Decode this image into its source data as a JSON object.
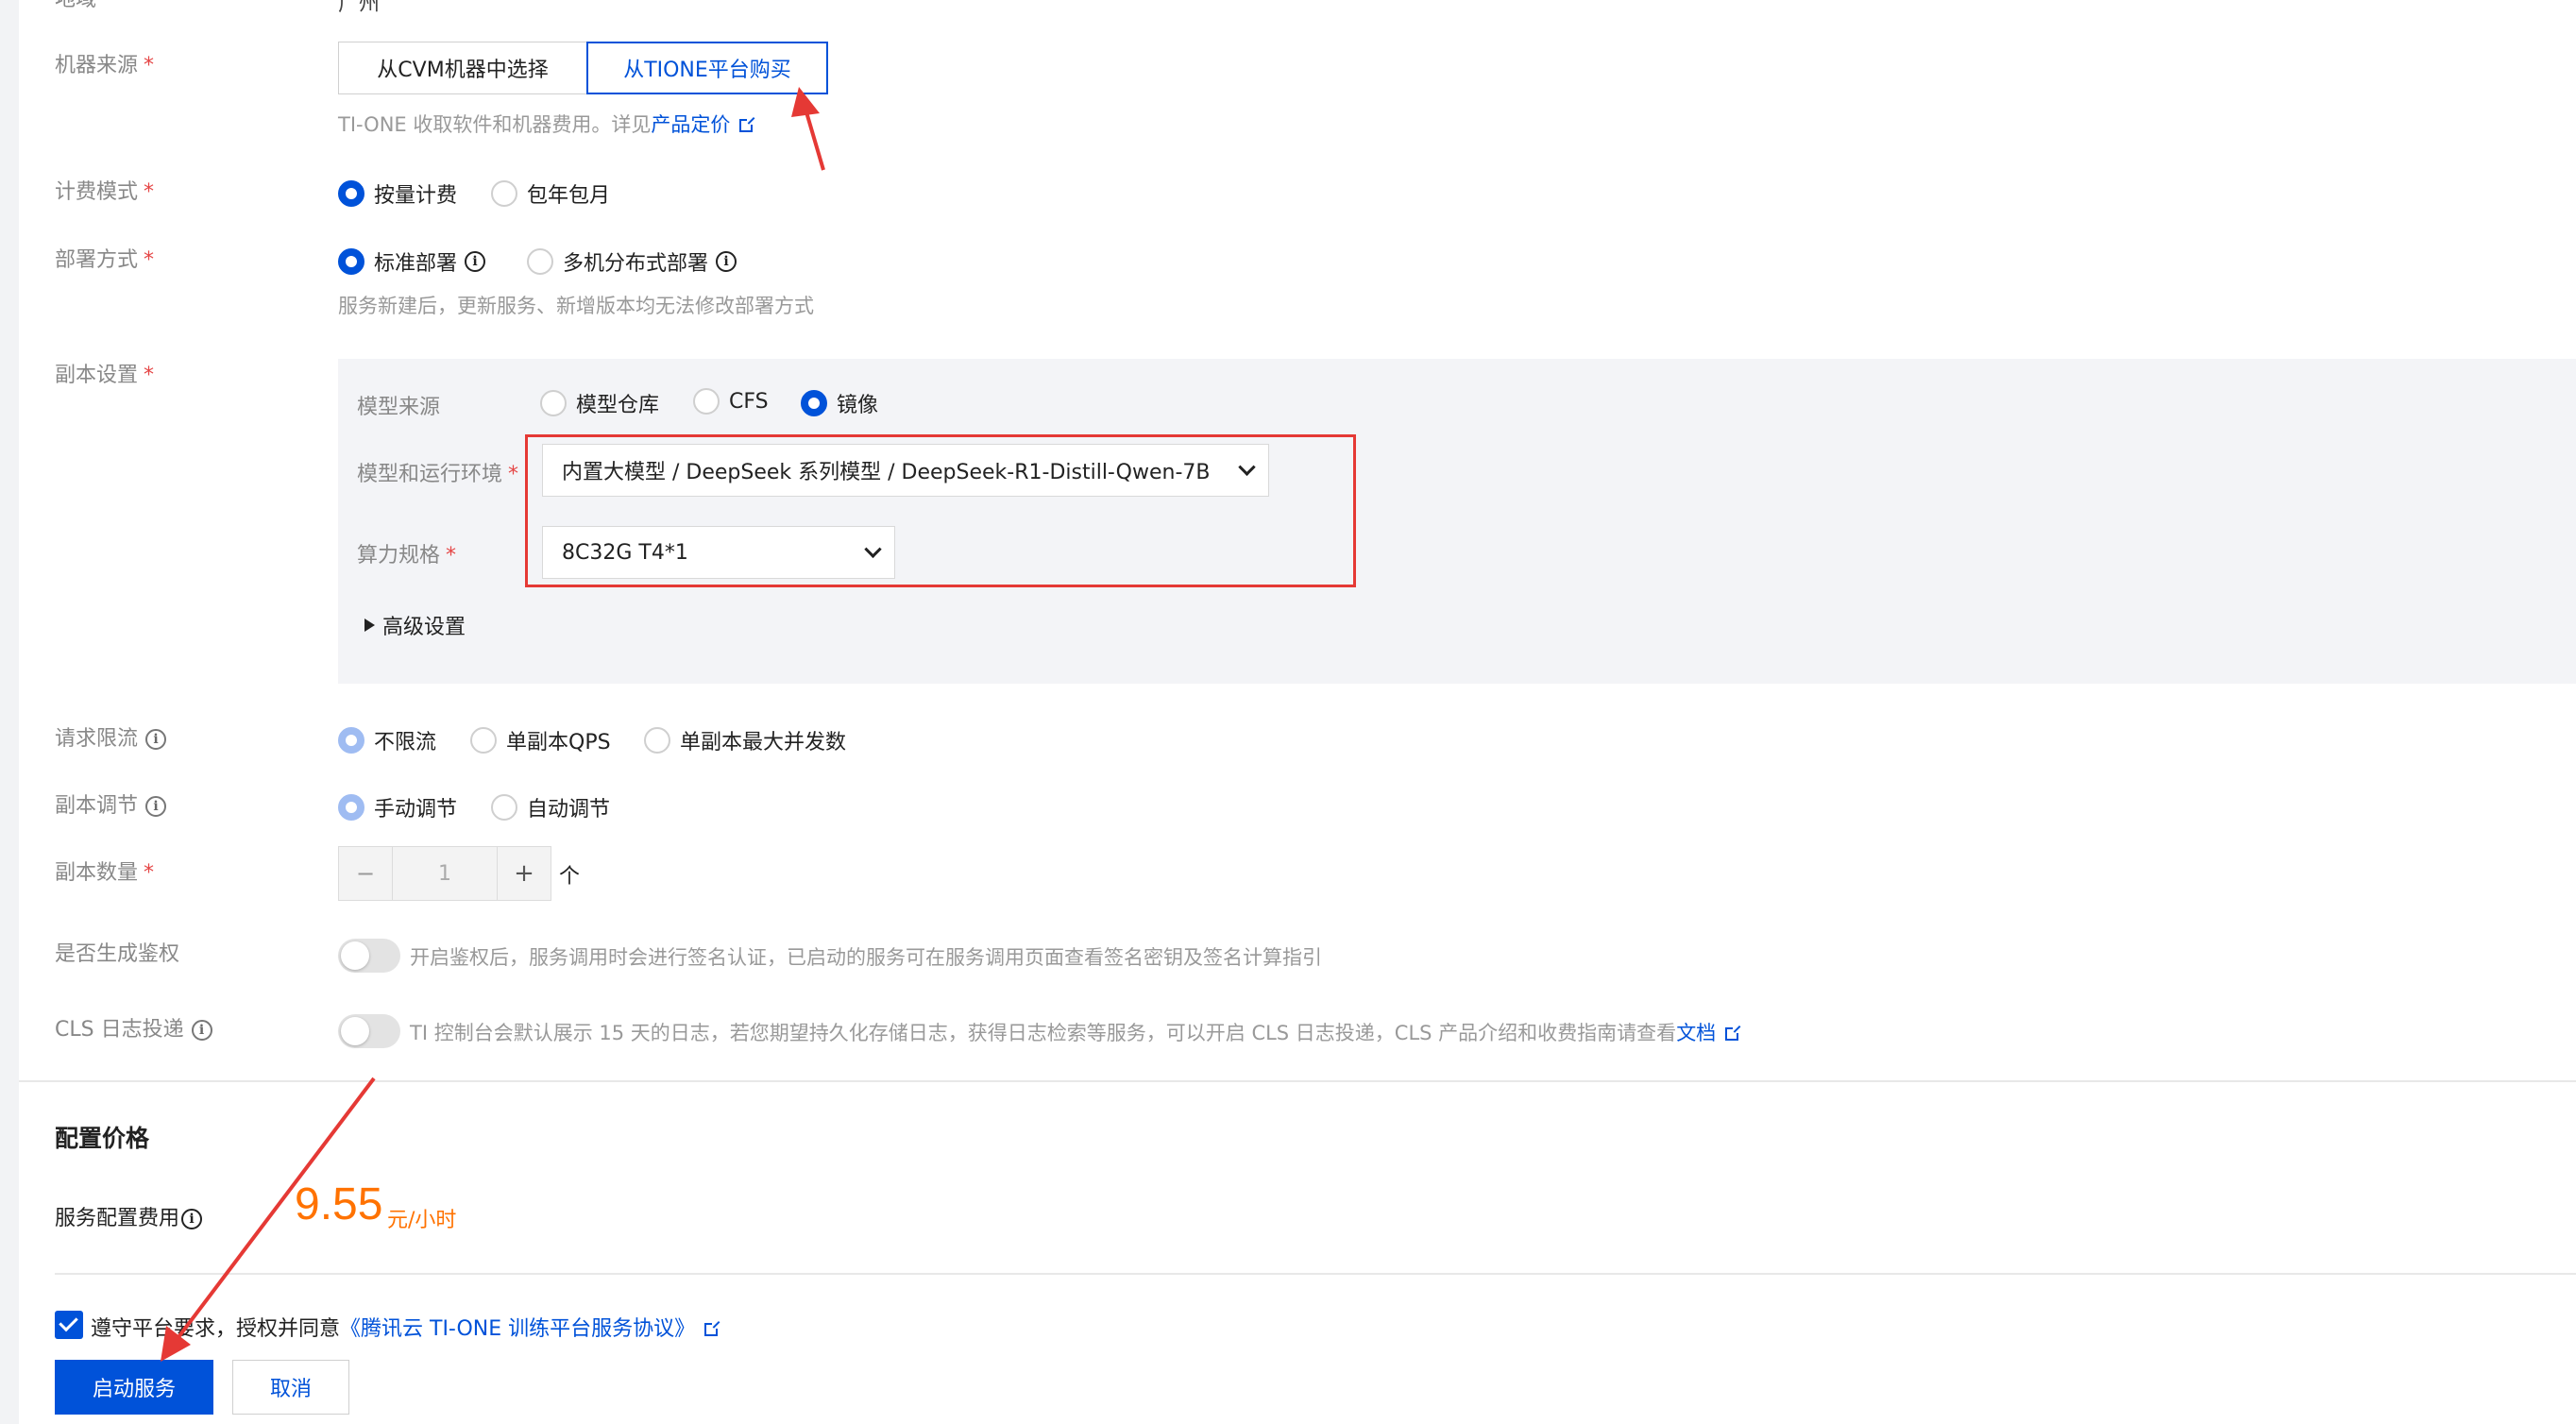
{
  "top_cut_label": "地域",
  "top_cut_value": "广州",
  "machine_source": {
    "label": "机器来源",
    "required_mark": "*",
    "option_cvm": "从CVM机器中选择",
    "option_tione": "从TIONE平台购买",
    "hint_text": "TI-ONE 收取软件和机器费用。详见",
    "hint_link": "产品定价"
  },
  "billing_mode": {
    "label": "计费模式",
    "required_mark": "*",
    "options": [
      "按量计费",
      "包年包月"
    ]
  },
  "deploy_mode": {
    "label": "部署方式",
    "required_mark": "*",
    "options": [
      "标准部署",
      "多机分布式部署"
    ],
    "hint": "服务新建后，更新服务、新增版本均无法修改部署方式"
  },
  "replica_settings": {
    "label": "副本设置",
    "required_mark": "*",
    "model_source_label": "模型来源",
    "model_source_options": [
      "模型仓库",
      "CFS",
      "镜像"
    ],
    "model_env_label": "模型和运行环境",
    "model_env_value": "内置大模型 / DeepSeek 系列模型 / DeepSeek-R1-Distill-Qwen-7B",
    "compute_label": "算力规格",
    "compute_value": "8C32G T4*1",
    "advanced_label": "高级设置"
  },
  "rate_limit": {
    "label": "请求限流",
    "options": [
      "不限流",
      "单副本QPS",
      "单副本最大并发数"
    ]
  },
  "replica_adjust": {
    "label": "副本调节",
    "options": [
      "手动调节",
      "自动调节"
    ]
  },
  "replica_count": {
    "label": "副本数量",
    "required_mark": "*",
    "minus": "−",
    "value": "1",
    "plus": "+",
    "unit": "个"
  },
  "auth": {
    "label": "是否生成鉴权",
    "hint": "开启鉴权后，服务调用时会进行签名认证，已启动的服务可在服务调用页面查看签名密钥及签名计算指引"
  },
  "cls": {
    "label": "CLS 日志投递",
    "hint": "TI 控制台会默认展示 15 天的日志，若您期望持久化存储日志，获得日志检索等服务，可以开启 CLS 日志投递，CLS 产品介绍和收费指南请查看",
    "hint_link": "文档"
  },
  "price": {
    "section_title": "配置价格",
    "fee_label": "服务配置费用",
    "amount": "9.55",
    "unit": "元/小时"
  },
  "agreement": {
    "text": "遵守平台要求，授权并同意",
    "link": "《腾讯云 TI-ONE 训练平台服务协议》"
  },
  "actions": {
    "start": "启动服务",
    "cancel": "取消"
  },
  "colors": {
    "primary": "#0052d9",
    "price": "#ff7200",
    "annotation_red": "#e53935"
  }
}
